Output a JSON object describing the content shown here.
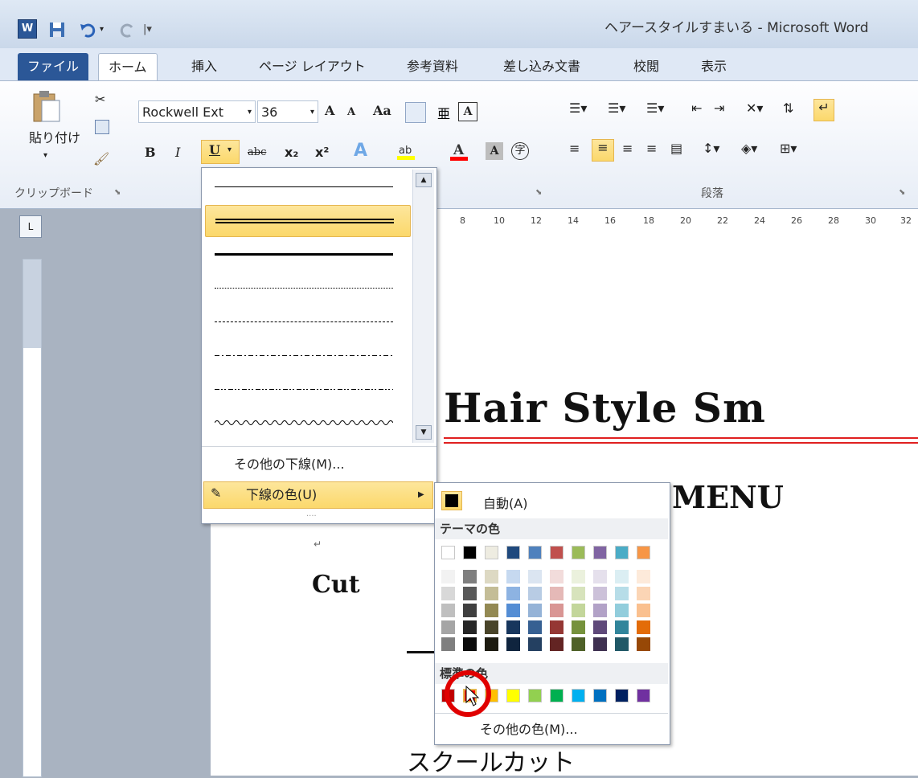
{
  "window": {
    "title": "ヘアースタイルすまいる - Microsoft Word"
  },
  "tabs": [
    {
      "label": "ファイル"
    },
    {
      "label": "ホーム"
    },
    {
      "label": "挿入"
    },
    {
      "label": "ページ レイアウト"
    },
    {
      "label": "参考資料"
    },
    {
      "label": "差し込み文書"
    },
    {
      "label": "校閲"
    },
    {
      "label": "表示"
    }
  ],
  "ribbon": {
    "paste_label": "貼り付け",
    "clipboard_group": "クリップボード",
    "paragraph_group": "段落",
    "font_name": "Rockwell Ext",
    "font_size": "36",
    "bold": "B",
    "italic": "I",
    "underline": "U",
    "strikethrough": "abc",
    "subscript": "x₂",
    "superscript": "x²",
    "font_color_letter": "A",
    "change_case": "Aa",
    "grow_font": "A",
    "shrink_font": "A"
  },
  "ruler": {
    "numbers": [
      "8",
      "10",
      "12",
      "14",
      "16",
      "18",
      "20",
      "22",
      "24",
      "26",
      "28",
      "30",
      "32"
    ]
  },
  "underline_menu": {
    "more_underlines": "その他の下線(M)...",
    "underline_color": "下線の色(U)"
  },
  "color_menu": {
    "automatic": "自動(A)",
    "theme_colors_label": "テーマの色",
    "standard_colors_label": "標準の色",
    "more_colors": "その他の色(M)...",
    "theme_top": [
      "#ffffff",
      "#000000",
      "#eeece1",
      "#1f497d",
      "#4f81bd",
      "#c0504d",
      "#9bbb59",
      "#8064a2",
      "#4bacc6",
      "#f79646"
    ],
    "theme_shades": [
      [
        "#f2f2f2",
        "#d8d8d8",
        "#bfbfbf",
        "#a5a5a5",
        "#7f7f7f"
      ],
      [
        "#7f7f7f",
        "#595959",
        "#3f3f3f",
        "#262626",
        "#0c0c0c"
      ],
      [
        "#ddd9c3",
        "#c4bd97",
        "#938953",
        "#494429",
        "#1d1b10"
      ],
      [
        "#c6d9f0",
        "#8db3e2",
        "#548dd4",
        "#17365d",
        "#0f243e"
      ],
      [
        "#dbe5f1",
        "#b8cce4",
        "#95b3d7",
        "#366092",
        "#244061"
      ],
      [
        "#f2dcdb",
        "#e5b9b7",
        "#d99694",
        "#953734",
        "#632423"
      ],
      [
        "#ebf1dd",
        "#d7e3bc",
        "#c3d69b",
        "#76923c",
        "#4f6128"
      ],
      [
        "#e5e0ec",
        "#ccc1d9",
        "#b2a2c7",
        "#5f497a",
        "#3f3151"
      ],
      [
        "#dbeef3",
        "#b7dde8",
        "#92cddc",
        "#31859b",
        "#205867"
      ],
      [
        "#fdeada",
        "#fbd5b5",
        "#fac08f",
        "#e36c09",
        "#974806"
      ]
    ],
    "standard": [
      "#c00000",
      "#ff0000",
      "#ffc000",
      "#ffff00",
      "#92d050",
      "#00b050",
      "#00b0f0",
      "#0070c0",
      "#002060",
      "#7030a0"
    ]
  },
  "document": {
    "heading": "Hair Style Sm",
    "menu_title": "MENU",
    "cut_label": "Cut",
    "school_cut": "スクールカット"
  }
}
